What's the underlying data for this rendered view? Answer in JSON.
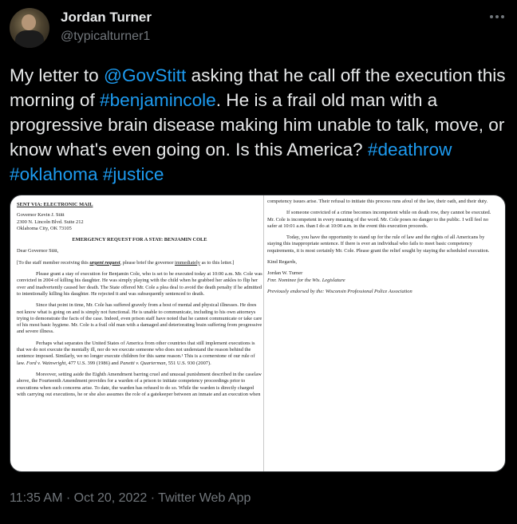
{
  "user": {
    "display_name": "Jordan Turner",
    "handle": "@typicalturner1"
  },
  "tweet": {
    "text_1": "My letter to ",
    "mention": "@GovStitt",
    "text_2": " asking that he call off the execution this morning of ",
    "hashtag_1": "#benjamincole",
    "text_3": ". He is a frail old man with a progressive brain disease making him unable to talk, move, or know what's even going on. Is this America? ",
    "hashtag_2": "#deathrow",
    "hashtag_3": "#oklahoma",
    "hashtag_4": "#justice",
    "timestamp": "11:35 AM · Oct 20, 2022 · Twitter Web App"
  },
  "letter": {
    "sent_via": "SENT VIA: ELECTRONIC MAIL",
    "addr_1": "Governor Kevin J. Stitt",
    "addr_2": "2300 N. Lincoln Blvd. Suite 212",
    "addr_3": "Oklahoma City, OK 73105",
    "heading": "EMERGENCY REQUEST FOR A STAY: BENJAMIN COLE",
    "salutation": "Dear Governor Stitt,",
    "staff_1": "[To the staff member receiving this ",
    "staff_urgent": "urgent request",
    "staff_2": ", please brief the governor ",
    "staff_immediately": "immediately",
    "staff_3": " as to this letter.]",
    "p1": "Please grant a stay of execution for Benjamin Cole, who is set to be executed today at 10:00 a.m. Mr. Cole was convicted in 2004 of killing his daughter. He was simply playing with the child when he grabbed her ankles to flip her over and inadvertently caused her death. The State offered Mr. Cole a plea deal to avoid the death penalty if he admitted to intentionally killing his daughter. He rejected it and was subsequently sentenced to death.",
    "p2": "Since that point in time, Mr. Cole has suffered gravely from a host of mental and physical illnesses. He does not know what is going on and is simply not functional. He is unable to communicate, including to his own attorneys trying to demonstrate the facts of the case. Indeed, even prison staff have noted that he cannot communicate or take care of his most basic hygiene. Mr. Cole is a frail old man with a damaged and deteriorating brain suffering from progressive and severe illness.",
    "p3_1": "Perhaps what separates the United States of America from other countries that still implement executions is that we do not execute the mentally ill, nor do we execute someone who does not understand the reason behind the sentence imposed. Similarly, we no longer execute children for this same reason.¹ This is a cornerstone of our rule of law. ",
    "p3_cite1": "Ford v. Wainwright",
    "p3_2": ", 477 U.S. 399 (1986) and ",
    "p3_cite2": "Panetti v. Quarterman",
    "p3_3": ", 551 U.S. 930 (2007).",
    "p4": "Moreover, setting aside the Eighth Amendment barring cruel and unusual punishment described in the caselaw above, the Fourteenth Amendment provides for a warden of a prison to initiate competency proceedings prior to executions when such concerns arise. To date, the warden has refused to do so. While the warden is directly charged with carrying out executions, he or she also assumes the role of a gatekeeper between an inmate and an execution when",
    "r1": "competency issues arise. Their refusal to initiate this process runs afoul of the law, their oath, and their duty.",
    "r2": "If someone convicted of a crime becomes incompetent while on death row, they cannot be executed. Mr. Cole is incompetent in every meaning of the word. Mr. Cole poses no danger to the public. I will feel no safer at 10:01 a.m. than I do at 10:00 a.m. in the event this execution proceeds.",
    "r3": "Today, you have the opportunity to stand up for the rule of law and the rights of all Americans by staying this inappropriate sentence. If there is ever an individual who fails to meet basic competency requirements, it is most certainly Mr. Cole. Please grant the relief sought by staying the scheduled execution.",
    "closing": "Kind Regards,",
    "sig_name": "Jordan W. Turner",
    "sig_title": "Fmr. Nominee for the Wis. Legislature",
    "endorsed": "Previously endorsed by the: Wisconsin Professional Police Association"
  }
}
